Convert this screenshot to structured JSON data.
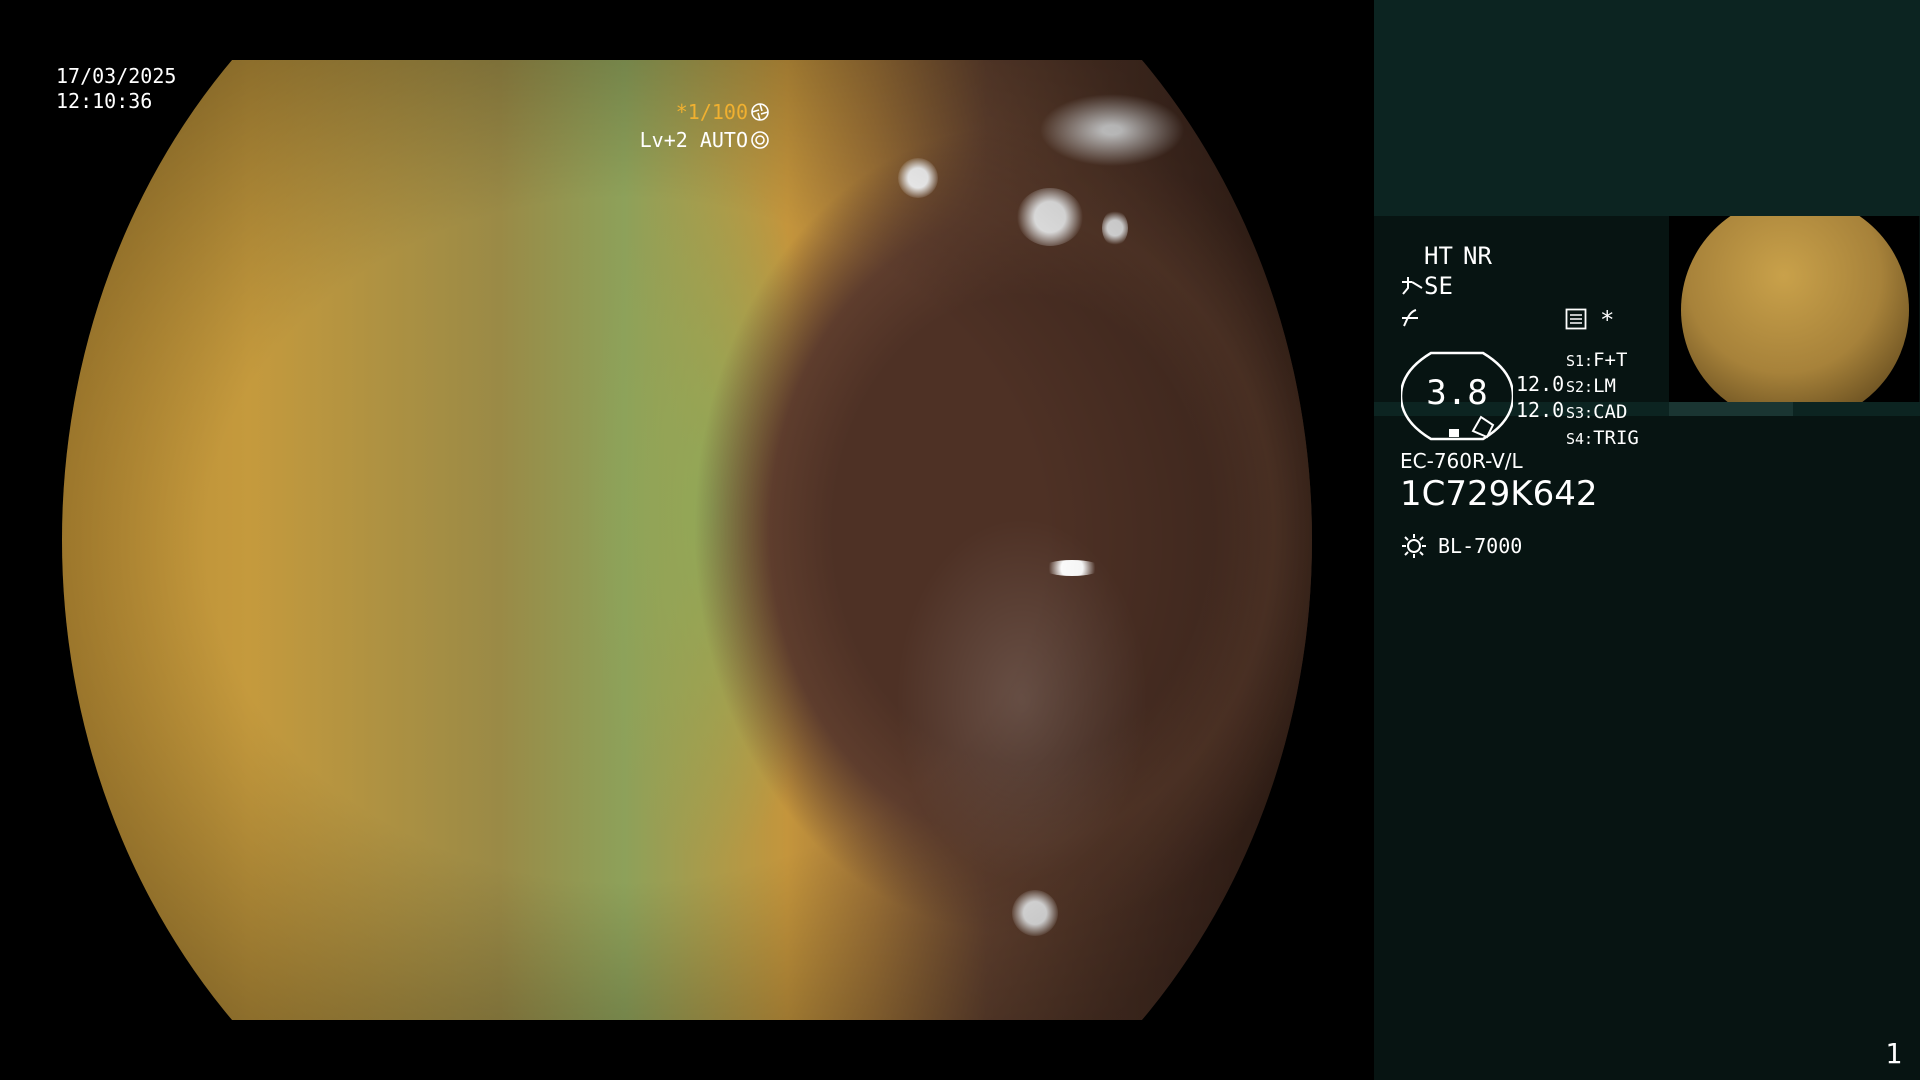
{
  "datetime": {
    "date": "17/03/2025",
    "time": "12:10:36"
  },
  "overlay": {
    "shutter": "*1/100",
    "level": "Lv+2",
    "mode": "AUTO"
  },
  "status": {
    "ht": "HT",
    "nr": "NR",
    "se": "SE",
    "asterisk": "*",
    "gauge_value": "3.8",
    "value_1": "12.0",
    "value_2": "12.0",
    "switches": [
      {
        "key": "S1:",
        "value": "F+T"
      },
      {
        "key": "S2:",
        "value": "LM"
      },
      {
        "key": "S3:",
        "value": "CAD"
      },
      {
        "key": "S4:",
        "value": "TRIG"
      }
    ]
  },
  "scope": {
    "model": "EC-760R-V/L",
    "serial": "1C729K642",
    "light_source": "BL-7000"
  },
  "page_number": "1",
  "colors": {
    "accent": "#f0b030",
    "panel_bg": "#071412",
    "panel_top": "#0c2421"
  }
}
